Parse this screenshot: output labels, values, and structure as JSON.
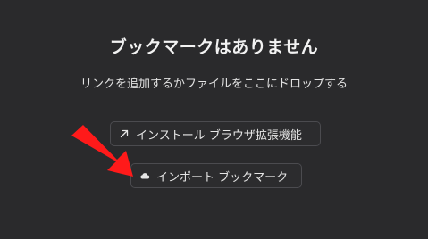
{
  "empty_state": {
    "title": "ブックマークはありません",
    "subtitle": "リンクを追加するかファイルをここにドロップする"
  },
  "actions": {
    "install_extension": {
      "label": "インストール ブラウザ拡張機能",
      "icon": "arrow-up-right-icon"
    },
    "import_bookmarks": {
      "label": "インポート ブックマーク",
      "icon": "cloud-icon"
    }
  },
  "colors": {
    "background": "#2a2a2c",
    "button_border": "#4b4b4f",
    "annotation_arrow": "#ff1a1a"
  }
}
